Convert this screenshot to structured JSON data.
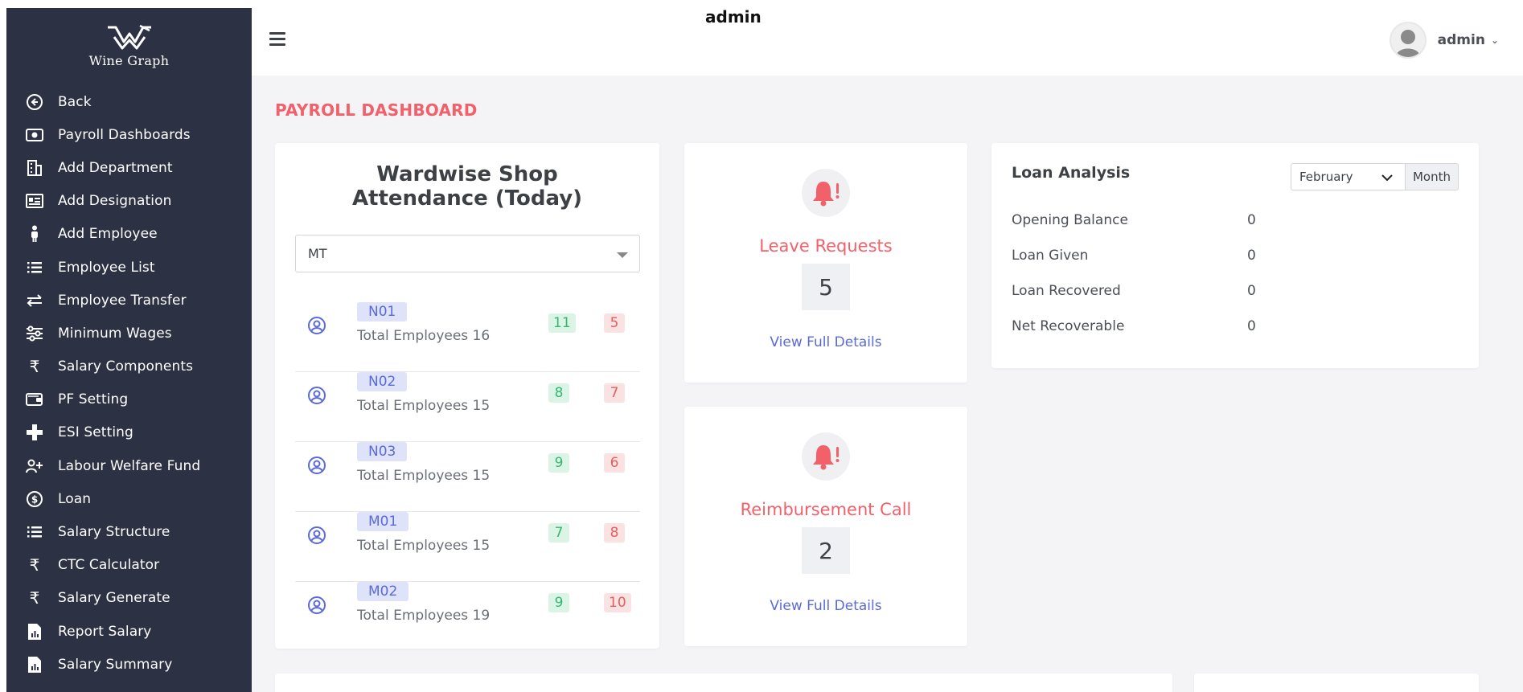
{
  "brand": {
    "name": "Wine Graph"
  },
  "sidebar": {
    "items": [
      {
        "label": "Back",
        "icon": "arrow-left-circle-icon"
      },
      {
        "label": "Payroll Dashboards",
        "icon": "camera-icon"
      },
      {
        "label": "Add Department",
        "icon": "building-icon"
      },
      {
        "label": "Add Designation",
        "icon": "id-card-icon"
      },
      {
        "label": "Add Employee",
        "icon": "person-icon"
      },
      {
        "label": "Employee List",
        "icon": "list-icon"
      },
      {
        "label": "Employee Transfer",
        "icon": "transfer-arrows-icon"
      },
      {
        "label": "Minimum Wages",
        "icon": "sliders-icon"
      },
      {
        "label": "Salary Components",
        "icon": "rupee-icon"
      },
      {
        "label": "PF Setting",
        "icon": "wallet-icon"
      },
      {
        "label": "ESI Setting",
        "icon": "plus-icon"
      },
      {
        "label": "Labour Welfare Fund",
        "icon": "user-plus-icon"
      },
      {
        "label": "Loan",
        "icon": "dollar-circle-icon"
      },
      {
        "label": "Salary Structure",
        "icon": "list-icon"
      },
      {
        "label": "CTC Calculator",
        "icon": "rupee-icon"
      },
      {
        "label": "Salary Generate",
        "icon": "rupee-icon"
      },
      {
        "label": "Report Salary",
        "icon": "report-file-icon"
      },
      {
        "label": "Salary Summary",
        "icon": "report-file-icon"
      }
    ]
  },
  "header": {
    "title": "admin",
    "user": "admin"
  },
  "main": {
    "page_title": "PAYROLL DASHBOARD"
  },
  "attendance": {
    "title": "Wardwise Shop Attendance (Today)",
    "selected": "MT",
    "rows": [
      {
        "code": "N01",
        "total": "Total Employees 16",
        "present": "11",
        "absent": "5"
      },
      {
        "code": "N02",
        "total": "Total Employees 15",
        "present": "8",
        "absent": "7"
      },
      {
        "code": "N03",
        "total": "Total Employees 15",
        "present": "9",
        "absent": "6"
      },
      {
        "code": "M01",
        "total": "Total Employees 15",
        "present": "7",
        "absent": "8"
      },
      {
        "code": "M02",
        "total": "Total Employees 19",
        "present": "9",
        "absent": "10"
      }
    ]
  },
  "leave": {
    "title": "Leave Requests",
    "count": "5",
    "link": "View Full Details"
  },
  "reimbursement": {
    "title": "Reimbursement Call",
    "count": "2",
    "link": "View Full Details"
  },
  "loan": {
    "title": "Loan Analysis",
    "month": "February",
    "month_button": "Month",
    "rows": [
      {
        "label": "Opening Balance",
        "value": "0"
      },
      {
        "label": "Loan Given",
        "value": "0"
      },
      {
        "label": "Loan Recovered",
        "value": "0"
      },
      {
        "label": "Net Recoverable",
        "value": "0"
      }
    ]
  },
  "colors": {
    "sidebar_bg": "#2c3143",
    "accent": "#f2616a",
    "link": "#5a6ad8"
  }
}
